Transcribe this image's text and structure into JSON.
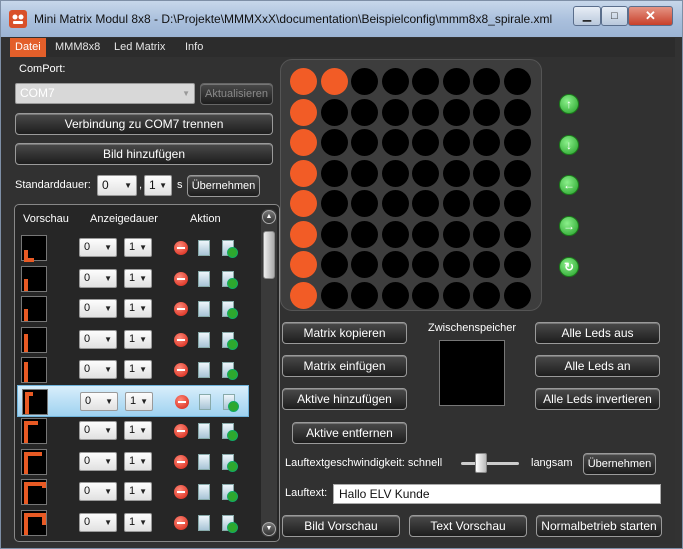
{
  "window": {
    "title": "Mini Matrix Modul 8x8 - D:\\Projekte\\MMMXxX\\documentation\\Beispielconfig\\mmm8x8_spirale.xml",
    "controls": {
      "minimize": "▁",
      "maximize": "□",
      "close": "✕"
    }
  },
  "menu": [
    "Datei",
    "MMM8x8",
    "Led Matrix",
    "Info"
  ],
  "comport": {
    "label": "ComPort:",
    "value": "COM7",
    "refresh_label": "Aktualisieren",
    "connect_label": "Verbindung zu COM7 trennen",
    "add_image_label": "Bild hinzufügen"
  },
  "standarddauer": {
    "label": "Standarddauer:",
    "value1": "0",
    "sep": ",",
    "value2": "1",
    "unit": "s",
    "apply_label": "Übernehmen"
  },
  "list": {
    "headers": {
      "preview": "Vorschau",
      "duration": "Anzeigedauer",
      "action": "Aktion"
    },
    "rows": [
      {
        "d1": "0",
        "d2": "1",
        "selected": false
      },
      {
        "d1": "0",
        "d2": "1",
        "selected": false
      },
      {
        "d1": "0",
        "d2": "1",
        "selected": false
      },
      {
        "d1": "0",
        "d2": "1",
        "selected": false
      },
      {
        "d1": "0",
        "d2": "1",
        "selected": false
      },
      {
        "d1": "0",
        "d2": "1",
        "selected": true
      },
      {
        "d1": "0",
        "d2": "1",
        "selected": false
      },
      {
        "d1": "0",
        "d2": "1",
        "selected": false
      },
      {
        "d1": "0",
        "d2": "1",
        "selected": false
      },
      {
        "d1": "0",
        "d2": "1",
        "selected": false
      }
    ],
    "scroll": {
      "up": "▲",
      "down": "▼"
    }
  },
  "matrix": {
    "rows": 8,
    "cols": 8,
    "on_color": "#f25c26",
    "off_color": "#000000",
    "leds": [
      [
        1,
        1,
        0,
        0,
        0,
        0,
        0,
        0
      ],
      [
        1,
        0,
        0,
        0,
        0,
        0,
        0,
        0
      ],
      [
        1,
        0,
        0,
        0,
        0,
        0,
        0,
        0
      ],
      [
        1,
        0,
        0,
        0,
        0,
        0,
        0,
        0
      ],
      [
        1,
        0,
        0,
        0,
        0,
        0,
        0,
        0
      ],
      [
        1,
        0,
        0,
        0,
        0,
        0,
        0,
        0
      ],
      [
        1,
        0,
        0,
        0,
        0,
        0,
        0,
        0
      ],
      [
        1,
        0,
        0,
        0,
        0,
        0,
        0,
        0
      ]
    ]
  },
  "arrows": {
    "up": "↑",
    "down": "↓",
    "left": "←",
    "right": "→",
    "rotate": "↻"
  },
  "buttons": {
    "copy_matrix": "Matrix kopieren",
    "paste_matrix": "Matrix einfügen",
    "add_active": "Aktive hinzufügen",
    "remove_active": "Aktive entfernen",
    "clipboard_label": "Zwischenspeicher",
    "all_off": "Alle Leds aus",
    "all_on": "Alle Leds an",
    "invert_all": "Alle Leds invertieren"
  },
  "lauftext": {
    "speed_label": "Lauftextgeschwindigkeit: schnell",
    "slow_label": "langsam",
    "speed_fraction": 0.3,
    "apply_label": "Übernehmen",
    "text_label": "Lauftext:",
    "text_value": "Hallo ELV Kunde"
  },
  "bottom_buttons": {
    "image_preview": "Bild Vorschau",
    "text_preview": "Text Vorschau",
    "start_normal": "Normalbetrieb starten"
  },
  "colors": {
    "accent": "#e35f2a",
    "background": "#313131",
    "led_on": "#f25c26"
  }
}
